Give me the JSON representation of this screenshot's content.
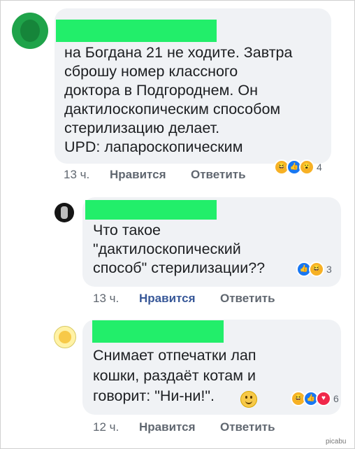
{
  "comments": [
    {
      "text": "на Богдана 21 не ходите. Завтра\nсброшу номер классного\nдоктора в Подгороднем. Он\nдактилоскопическим способом\nстерилизацию делает.\nUPD: лапароскопическим",
      "time": "13 ч.",
      "like": "Нравится",
      "reply": "Ответить",
      "reactions": [
        "haha",
        "like",
        "wow"
      ],
      "reaction_count": "4"
    },
    {
      "text": "Что такое\n\"дактилоскопический\nспособ\" стерилизации??",
      "time": "13 ч.",
      "like": "Нравится",
      "reply": "Ответить",
      "reactions": [
        "like",
        "haha"
      ],
      "reaction_count": "3",
      "liked": true
    },
    {
      "text": "Снимает отпечатки лап\nкошки, раздаёт котам и\nговорит: \"Ни-ни!\".",
      "time": "12 ч.",
      "like": "Нравится",
      "reply": "Ответить",
      "reactions": [
        "haha",
        "like",
        "love"
      ],
      "reaction_count": "6"
    }
  ],
  "watermark": "picabu"
}
